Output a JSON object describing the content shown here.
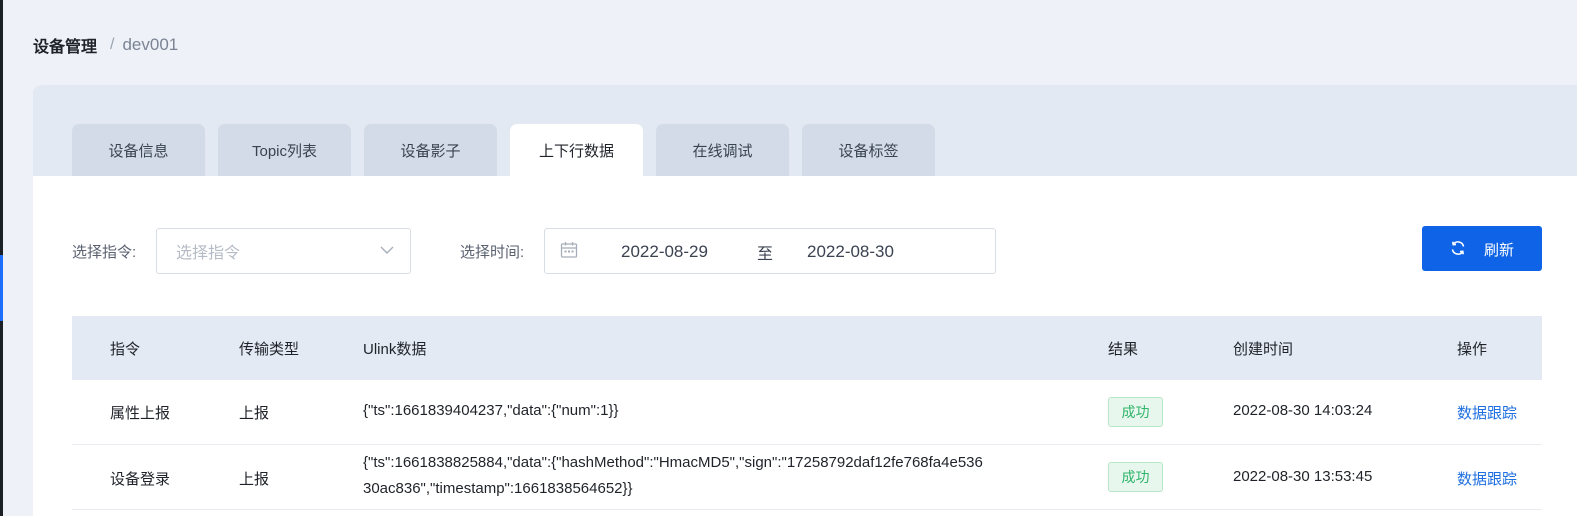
{
  "breadcrumb": {
    "root": "设备管理",
    "separator": "/",
    "current": "dev001"
  },
  "tabs": [
    {
      "label": "设备信息",
      "active": false
    },
    {
      "label": "Topic列表",
      "active": false
    },
    {
      "label": "设备影子",
      "active": false
    },
    {
      "label": "上下行数据",
      "active": true
    },
    {
      "label": "在线调试",
      "active": false
    },
    {
      "label": "设备标签",
      "active": false
    }
  ],
  "filters": {
    "command_label": "选择指令:",
    "command_placeholder": "选择指令",
    "time_label": "选择时间:",
    "date_start": "2022-08-29",
    "date_to": "至",
    "date_end": "2022-08-30"
  },
  "refresh": {
    "label": "刷新",
    "icon": "refresh-icon",
    "color": "#0f63e6"
  },
  "table": {
    "headers": [
      "指令",
      "传输类型",
      "Ulink数据",
      "结果",
      "创建时间",
      "操作"
    ],
    "rows": [
      {
        "command": "属性上报",
        "transfer": "上报",
        "data_lines": [
          "{\"ts\":1661839404237,\"data\":{\"num\":1}}"
        ],
        "result": "成功",
        "created": "2022-08-30 14:03:24",
        "action": "数据跟踪"
      },
      {
        "command": "设备登录",
        "transfer": "上报",
        "data_lines": [
          "{\"ts\":1661838825884,\"data\":{\"hashMethod\":\"HmacMD5\",\"sign\":\"17258792daf12fe768fa4e536",
          "30ac836\",\"timestamp\":1661838564652}}"
        ],
        "result": "成功",
        "created": "2022-08-30 13:53:45",
        "action": "数据跟踪"
      }
    ]
  },
  "colors": {
    "accent": "#0f63e6",
    "success": "#2fb46a",
    "link": "#1f6fe0"
  }
}
